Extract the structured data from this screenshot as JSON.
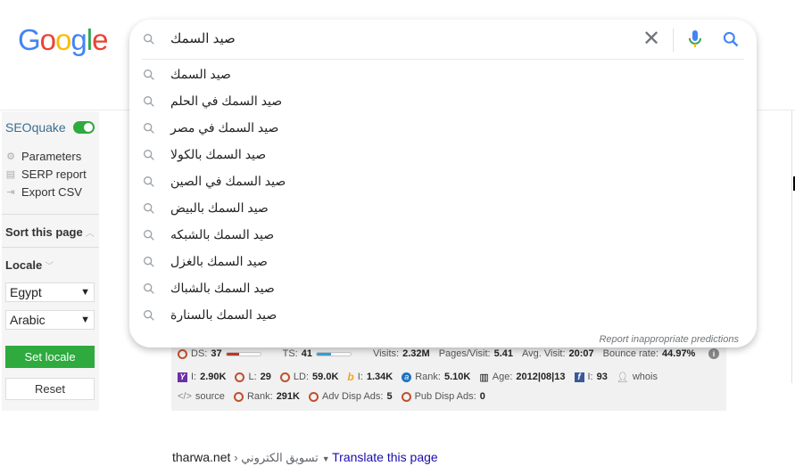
{
  "logo": "Google",
  "search": {
    "query": "صيد  السمك",
    "clear_icon": "close-icon",
    "mic_icon": "mic-icon",
    "search_icon": "search-icon"
  },
  "suggestions": [
    "صيد السمك",
    "صيد السمك في الحلم",
    "صيد السمك في مصر",
    "صيد السمك بالكولا",
    "صيد السمك في الصين",
    "صيد السمك بالبيض",
    "صيد السمك بالشبكه",
    "صيد السمك بالغزل",
    "صيد السمك بالشباك",
    "صيد السمك بالسنارة"
  ],
  "report_link": "Report inappropriate predictions",
  "sidebar": {
    "title": "SEOquake",
    "toggle_on": true,
    "items": [
      {
        "label": "Parameters",
        "icon": "gear-icon"
      },
      {
        "label": "SERP report",
        "icon": "list-icon"
      },
      {
        "label": "Export CSV",
        "icon": "export-icon"
      }
    ],
    "sort_label": "Sort this page",
    "locale_label": "Locale",
    "country": "Egypt",
    "language": "Arabic",
    "set_locale": "Set locale",
    "reset": "Reset",
    "accent": "#2eaa3e"
  },
  "seobar": {
    "row1": {
      "ds_label": "DS:",
      "ds": "37",
      "ds_fill": 37,
      "ts_label": "TS:",
      "ts": "41",
      "ts_fill": 41,
      "visits_label": "Visits:",
      "visits": "2.32M",
      "ppv_label": "Pages/Visit:",
      "ppv": "5.41",
      "avg_label": "Avg. Visit:",
      "avg": "20:07",
      "bounce_label": "Bounce rate:",
      "bounce": "44.97%"
    },
    "row2": {
      "y_label": "I:",
      "y": "2.90K",
      "l_label": "L:",
      "l": "29",
      "ld_label": "LD:",
      "ld": "59.0K",
      "b_label": "I:",
      "b": "1.34K",
      "rank_label": "Rank:",
      "rank": "5.10K",
      "age_label": "Age:",
      "age": "2012|08|13",
      "fb_label": "I:",
      "fb": "93",
      "whois": "whois"
    },
    "row3": {
      "source": "source",
      "rank_label": "Rank:",
      "rank": "291K",
      "adv_label": "Adv Disp Ads:",
      "adv": "5",
      "pub_label": "Pub Disp Ads:",
      "pub": "0"
    }
  },
  "result": {
    "domain": "tharwa.net",
    "breadcrumb": "تسويق الكتروني",
    "translate": "Translate this page"
  }
}
